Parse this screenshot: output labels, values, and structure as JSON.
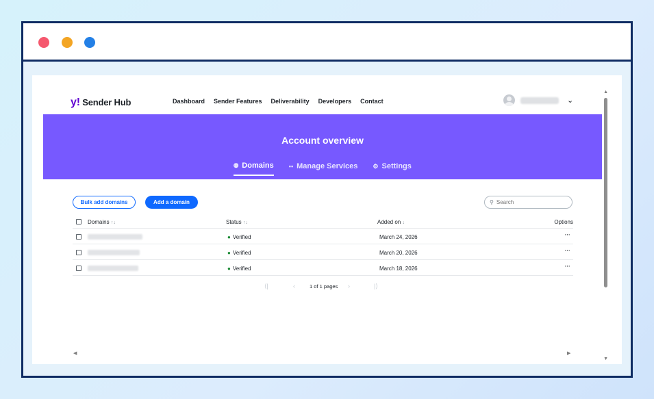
{
  "header": {
    "logo_mark": "y!",
    "logo_text": "Sender Hub",
    "nav": [
      "Dashboard",
      "Sender Features",
      "Deliverability",
      "Developers",
      "Contact"
    ]
  },
  "banner": {
    "title": "Account overview",
    "tabs": [
      {
        "label": "Domains",
        "icon": "globe-icon",
        "active": true
      },
      {
        "label": "Manage Services",
        "icon": "grid-icon",
        "active": false
      },
      {
        "label": "Settings",
        "icon": "gear-icon",
        "active": false
      }
    ]
  },
  "actions": {
    "bulk_add_label": "Bulk add domains",
    "add_label": "Add a domain",
    "search_placeholder": "Search"
  },
  "table": {
    "columns": {
      "domain": "Domains",
      "status": "Status",
      "added": "Added on",
      "options": "Options"
    },
    "sort_symbols": {
      "domain": "↑↓",
      "status": "↑↓",
      "added": "↓"
    },
    "rows": [
      {
        "status": "Verified",
        "added": "March 24, 2026",
        "options": "···"
      },
      {
        "status": "Verified",
        "added": "March 20, 2026",
        "options": "···"
      },
      {
        "status": "Verified",
        "added": "March 18, 2026",
        "options": "···"
      }
    ]
  },
  "pagination": {
    "text": "1 of 1 pages",
    "first": "⟨|",
    "prev": "‹",
    "next": "›",
    "last": "|⟩"
  },
  "colors": {
    "banner": "#7759ff",
    "primary": "#0f69ff",
    "verified": "#1a8a33",
    "frame": "#0f2c63"
  }
}
